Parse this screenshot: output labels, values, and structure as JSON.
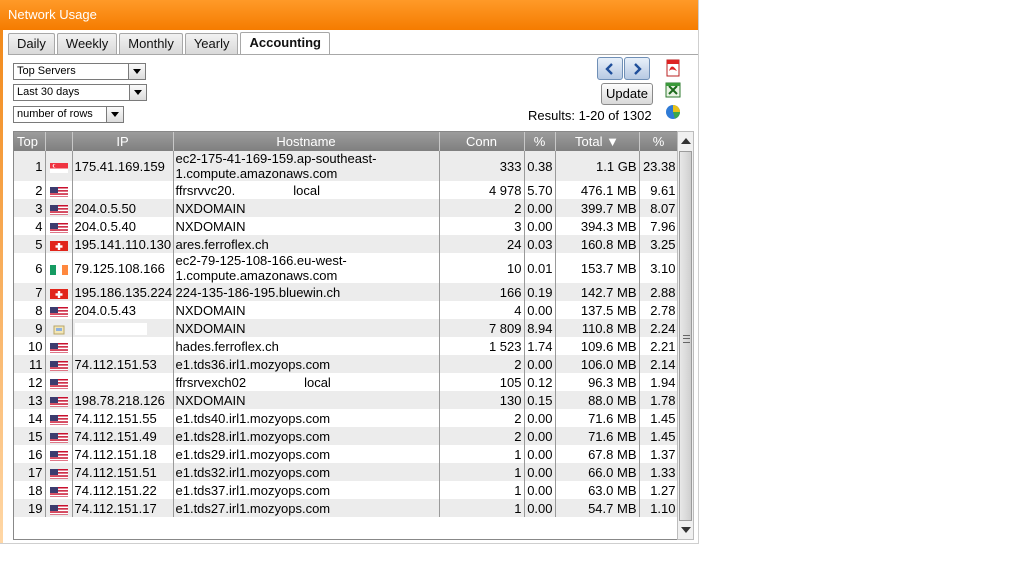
{
  "window": {
    "title": "Network Usage"
  },
  "tabs": [
    {
      "label": "Daily",
      "active": false
    },
    {
      "label": "Weekly",
      "active": false
    },
    {
      "label": "Monthly",
      "active": false
    },
    {
      "label": "Yearly",
      "active": false
    },
    {
      "label": "Accounting",
      "active": true
    }
  ],
  "filters": {
    "report": "Top Servers",
    "period": "Last 30 days",
    "rows": "number of rows"
  },
  "actions": {
    "update_label": "Update",
    "results_text": "Results: 1-20 of 1302"
  },
  "table": {
    "headers": [
      "Top",
      "",
      "IP",
      "Hostname",
      "Conn",
      "%",
      "Total",
      "%"
    ],
    "sort_indicator": "▼",
    "rows": [
      {
        "top": "1",
        "flag": "SG",
        "ip": "175.41.169.159",
        "host": "ec2-175-41-169-159.ap-southeast-1.compute.amazonaws.com",
        "conn": "333",
        "conn_pct": "0.38",
        "total": "1.1 GB",
        "total_pct": "23.38"
      },
      {
        "top": "2",
        "flag": "US",
        "ip": "",
        "host_pre": "ffrsrvvc20.",
        "host_post": "local",
        "conn": "4 978",
        "conn_pct": "5.70",
        "total": "476.1 MB",
        "total_pct": "9.61"
      },
      {
        "top": "3",
        "flag": "US",
        "ip": "204.0.5.50",
        "host": "NXDOMAIN",
        "conn": "2",
        "conn_pct": "0.00",
        "total": "399.7 MB",
        "total_pct": "8.07"
      },
      {
        "top": "4",
        "flag": "US",
        "ip": "204.0.5.40",
        "host": "NXDOMAIN",
        "conn": "3",
        "conn_pct": "0.00",
        "total": "394.3 MB",
        "total_pct": "7.96"
      },
      {
        "top": "5",
        "flag": "CH",
        "ip": "195.141.110.130",
        "host": "ares.ferroflex.ch",
        "conn": "24",
        "conn_pct": "0.03",
        "total": "160.8 MB",
        "total_pct": "3.25"
      },
      {
        "top": "6",
        "flag": "IE",
        "ip": "79.125.108.166",
        "host": "ec2-79-125-108-166.eu-west-1.compute.amazonaws.com",
        "conn": "10",
        "conn_pct": "0.01",
        "total": "153.7 MB",
        "total_pct": "3.10"
      },
      {
        "top": "7",
        "flag": "CH",
        "ip": "195.186.135.224",
        "host": "224-135-186-195.bluewin.ch",
        "conn": "166",
        "conn_pct": "0.19",
        "total": "142.7 MB",
        "total_pct": "2.88"
      },
      {
        "top": "8",
        "flag": "US",
        "ip": "204.0.5.43",
        "host": "NXDOMAIN",
        "conn": "4",
        "conn_pct": "0.00",
        "total": "137.5 MB",
        "total_pct": "2.78"
      },
      {
        "top": "9",
        "flag": "LAN",
        "ip": "",
        "host": "NXDOMAIN",
        "conn": "7 809",
        "conn_pct": "8.94",
        "total": "110.8 MB",
        "total_pct": "2.24"
      },
      {
        "top": "10",
        "flag": "US",
        "ip": "",
        "host": "hades.ferroflex.ch",
        "conn": "1 523",
        "conn_pct": "1.74",
        "total": "109.6 MB",
        "total_pct": "2.21"
      },
      {
        "top": "11",
        "flag": "US",
        "ip": "74.112.151.53",
        "host": "e1.tds36.irl1.mozyops.com",
        "conn": "2",
        "conn_pct": "0.00",
        "total": "106.0 MB",
        "total_pct": "2.14"
      },
      {
        "top": "12",
        "flag": "US",
        "ip": "",
        "host_pre": "ffrsrvexch02",
        "host_post": "local",
        "conn": "105",
        "conn_pct": "0.12",
        "total": "96.3 MB",
        "total_pct": "1.94"
      },
      {
        "top": "13",
        "flag": "US",
        "ip": "198.78.218.126",
        "host": "NXDOMAIN",
        "conn": "130",
        "conn_pct": "0.15",
        "total": "88.0 MB",
        "total_pct": "1.78"
      },
      {
        "top": "14",
        "flag": "US",
        "ip": "74.112.151.55",
        "host": "e1.tds40.irl1.mozyops.com",
        "conn": "2",
        "conn_pct": "0.00",
        "total": "71.6 MB",
        "total_pct": "1.45"
      },
      {
        "top": "15",
        "flag": "US",
        "ip": "74.112.151.49",
        "host": "e1.tds28.irl1.mozyops.com",
        "conn": "2",
        "conn_pct": "0.00",
        "total": "71.6 MB",
        "total_pct": "1.45"
      },
      {
        "top": "16",
        "flag": "US",
        "ip": "74.112.151.18",
        "host": "e1.tds29.irl1.mozyops.com",
        "conn": "1",
        "conn_pct": "0.00",
        "total": "67.8 MB",
        "total_pct": "1.37"
      },
      {
        "top": "17",
        "flag": "US",
        "ip": "74.112.151.51",
        "host": "e1.tds32.irl1.mozyops.com",
        "conn": "1",
        "conn_pct": "0.00",
        "total": "66.0 MB",
        "total_pct": "1.33"
      },
      {
        "top": "18",
        "flag": "US",
        "ip": "74.112.151.22",
        "host": "e1.tds37.irl1.mozyops.com",
        "conn": "1",
        "conn_pct": "0.00",
        "total": "63.0 MB",
        "total_pct": "1.27"
      },
      {
        "top": "19",
        "flag": "US",
        "ip": "74.112.151.17",
        "host": "e1.tds27.irl1.mozyops.com",
        "conn": "1",
        "conn_pct": "0.00",
        "total": "54.7 MB",
        "total_pct": "1.10"
      }
    ]
  },
  "icons": {
    "prev": "chevron-left-icon",
    "next": "chevron-right-icon",
    "pdf": "pdf-export-icon",
    "excel": "excel-export-icon",
    "chart": "pie-chart-icon"
  },
  "colors": {
    "titlebar": "#f57c00",
    "header": "#8c8c8c",
    "row_alt": "#ececec"
  }
}
